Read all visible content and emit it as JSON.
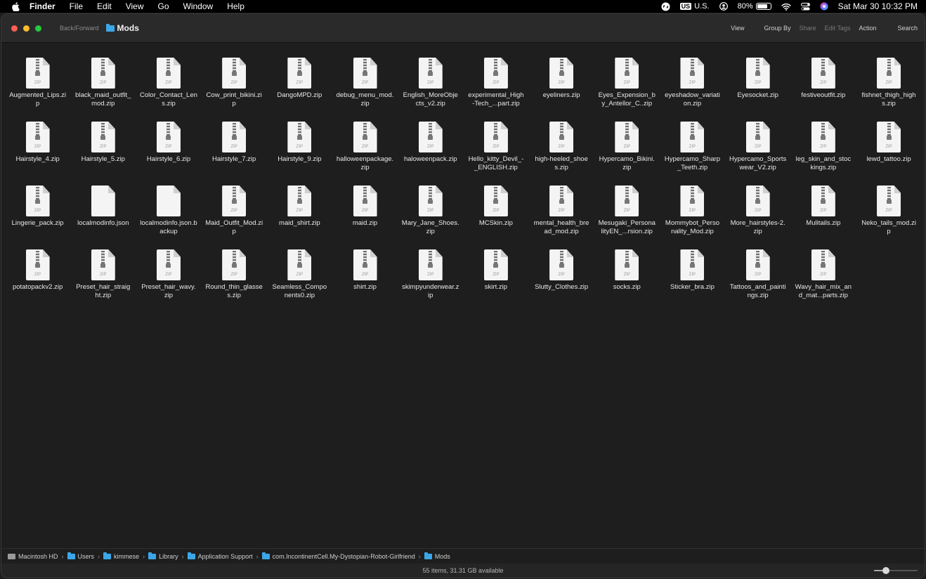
{
  "menubar": {
    "app": "Finder",
    "items": [
      "File",
      "Edit",
      "View",
      "Go",
      "Window",
      "Help"
    ],
    "tray": {
      "input_badge": "US",
      "input_label": "U.S.",
      "battery_percent": "80%",
      "battery_level": 0.8,
      "datetime": "Sat Mar 30  10:32 PM"
    }
  },
  "toolbar": {
    "back_forward": "Back/Forward",
    "title": "Mods",
    "view": "View",
    "group_by": "Group By",
    "share": "Share",
    "edit_tags": "Edit Tags",
    "action": "Action",
    "search": "Search"
  },
  "files": [
    {
      "name": "Augmented_Lips.zip",
      "type": "zip"
    },
    {
      "name": "black_maid_outfit_mod.zip",
      "type": "zip"
    },
    {
      "name": "Color_Contact_Lens.zip",
      "type": "zip"
    },
    {
      "name": "Cow_print_bikini.zip",
      "type": "zip"
    },
    {
      "name": "DangoMPD.zip",
      "type": "zip"
    },
    {
      "name": "debug_menu_mod.zip",
      "type": "zip"
    },
    {
      "name": "English_MoreObjects_v2.zip",
      "type": "zip"
    },
    {
      "name": "experimental_High-Tech_...part.zip",
      "type": "zip"
    },
    {
      "name": "eyeliners.zip",
      "type": "zip"
    },
    {
      "name": "Eyes_Expension_by_Antellor_C..zip",
      "type": "zip"
    },
    {
      "name": "eyeshadow_variation.zip",
      "type": "zip"
    },
    {
      "name": "Eyesocket.zip",
      "type": "zip"
    },
    {
      "name": "festiveoutfit.zip",
      "type": "zip"
    },
    {
      "name": "fishnet_thigh_highs.zip",
      "type": "zip"
    },
    {
      "name": "Hairstyle_4.zip",
      "type": "zip"
    },
    {
      "name": "Hairstyle_5.zip",
      "type": "zip"
    },
    {
      "name": "Hairstyle_6.zip",
      "type": "zip"
    },
    {
      "name": "Hairstyle_7.zip",
      "type": "zip"
    },
    {
      "name": "Hairstyle_9.zip",
      "type": "zip"
    },
    {
      "name": "halloweenpackage.zip",
      "type": "zip"
    },
    {
      "name": "haloweenpack.zip",
      "type": "zip"
    },
    {
      "name": "Hello_kitty_Devil_-_ENGLISH.zip",
      "type": "zip"
    },
    {
      "name": "high-heeled_shoes.zip",
      "type": "zip"
    },
    {
      "name": "Hypercamo_Bikini.zip",
      "type": "zip"
    },
    {
      "name": "Hypercamo_Sharp_Teeth.zip",
      "type": "zip"
    },
    {
      "name": "Hypercamo_Sportswear_V2.zip",
      "type": "zip"
    },
    {
      "name": "leg_skin_and_stockings.zip",
      "type": "zip"
    },
    {
      "name": "lewd_tattoo.zip",
      "type": "zip"
    },
    {
      "name": "Lingerie_pack.zip",
      "type": "zip"
    },
    {
      "name": "localmodinfo.json",
      "type": "doc"
    },
    {
      "name": "localmodinfo.json.backup",
      "type": "doc"
    },
    {
      "name": "Maid_Outfit_Mod.zip",
      "type": "zip"
    },
    {
      "name": "maid_shirt.zip",
      "type": "zip"
    },
    {
      "name": "maid.zip",
      "type": "zip"
    },
    {
      "name": "Mary_Jane_Shoes.zip",
      "type": "zip"
    },
    {
      "name": "MCSkin.zip",
      "type": "zip"
    },
    {
      "name": "mental_health_bread_mod.zip",
      "type": "zip"
    },
    {
      "name": "Mesugaki_PersonalityEN_...rsion.zip",
      "type": "zip"
    },
    {
      "name": "Mommybot_Personality_Mod.zip",
      "type": "zip"
    },
    {
      "name": "More_hairstyles-2.zip",
      "type": "zip"
    },
    {
      "name": "Mulitails.zip",
      "type": "zip"
    },
    {
      "name": "Neko_tails_mod.zip",
      "type": "zip"
    },
    {
      "name": "potatopackv2.zip",
      "type": "zip"
    },
    {
      "name": "Preset_hair_straight.zip",
      "type": "zip"
    },
    {
      "name": "Preset_hair_wavy.zip",
      "type": "zip"
    },
    {
      "name": "Round_thin_glasses.zip",
      "type": "zip"
    },
    {
      "name": "Seamless_Components0.zip",
      "type": "zip"
    },
    {
      "name": "shirt.zip",
      "type": "zip"
    },
    {
      "name": "skimpyunderwear.zip",
      "type": "zip"
    },
    {
      "name": "skirt.zip",
      "type": "zip"
    },
    {
      "name": "Slutty_Clothes.zip",
      "type": "zip"
    },
    {
      "name": "socks.zip",
      "type": "zip"
    },
    {
      "name": "Sticker_bra.zip",
      "type": "zip"
    },
    {
      "name": "Tattoos_and_paintings.zip",
      "type": "zip"
    },
    {
      "name": "Wavy_hair_mix_and_mat...parts.zip",
      "type": "zip"
    }
  ],
  "zip_label": "ZIP",
  "pathbar": [
    {
      "label": "Macintosh HD",
      "icon": "hard-drive-icon"
    },
    {
      "label": "Users",
      "icon": "folder-icon"
    },
    {
      "label": "kimmese",
      "icon": "folder-icon"
    },
    {
      "label": "Library",
      "icon": "folder-icon"
    },
    {
      "label": "Application Support",
      "icon": "folder-icon"
    },
    {
      "label": "com.IncontinentCell.My-Dystopian-Robot-Girlfriend",
      "icon": "folder-icon"
    },
    {
      "label": "Mods",
      "icon": "folder-icon"
    }
  ],
  "status": {
    "text": "55 items, 31.31 GB available",
    "icon_size_level": 0.27
  },
  "colors": {
    "folder": "#3ba7e8",
    "close": "#ff5f57",
    "minimize": "#febc2e",
    "zoom": "#28c840"
  }
}
